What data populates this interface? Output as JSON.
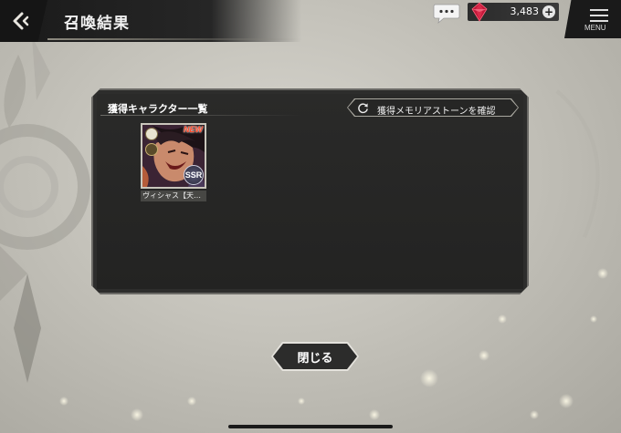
{
  "header": {
    "title": "召喚結果",
    "currency_value": "3,483",
    "menu_label": "MENU"
  },
  "panel": {
    "heading": "獲得キャラクター一覧",
    "memoria_button_label": "獲得メモリアストーンを確認"
  },
  "characters": [
    {
      "name": "ヴィシャス【天…",
      "new_label": "NEW",
      "rarity": "SSR"
    }
  ],
  "footer": {
    "close_label": "閉じる"
  },
  "icons": {
    "back": "back-arrow-icon",
    "chat": "chat-bubble-icon",
    "currency": "red-gem-icon",
    "add": "plus-icon",
    "menu": "hamburger-menu-icon",
    "refresh": "refresh-icon"
  },
  "colors": {
    "panel_bg": "#2d2d2c",
    "gem": "#c2183a",
    "new_badge": "#ff4a2a"
  }
}
